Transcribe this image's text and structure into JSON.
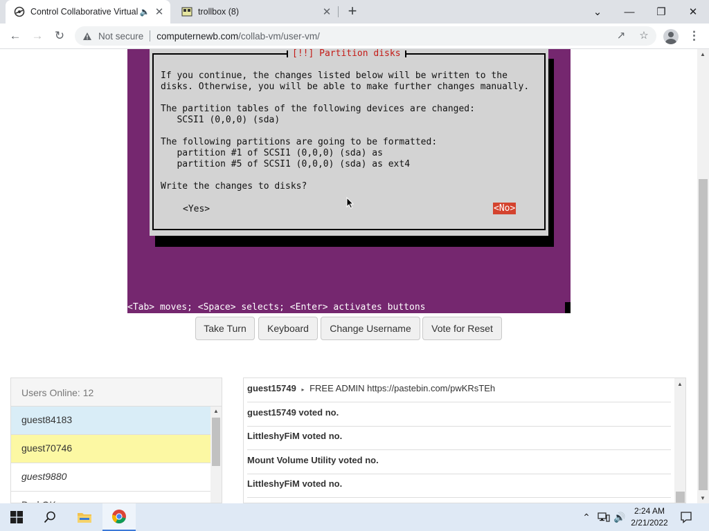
{
  "browser": {
    "tabs": [
      {
        "title": "Control Collaborative Virtual",
        "active": true,
        "audio": true
      },
      {
        "title": "trollbox (8)",
        "active": false
      }
    ],
    "security_label": "Not secure",
    "url_host": "computernewb.com",
    "url_path": "/collab-vm/user-vm/"
  },
  "vm": {
    "dialog_title": "[!!] Partition disks",
    "line1": "If you continue, the changes listed below will be written to the",
    "line2": "disks. Otherwise, you will be able to make further changes manually.",
    "line3": "The partition tables of the following devices are changed:",
    "line4": "   SCSI1 (0,0,0) (sda)",
    "line5": "The following partitions are going to be formatted:",
    "line6": "   partition #1 of SCSI1 (0,0,0) (sda) as",
    "line7": "   partition #5 of SCSI1 (0,0,0) (sda) as ext4",
    "line8": "Write the changes to disks?",
    "yes_label": "<Yes>",
    "no_label": "<No>",
    "help_line": "<Tab> moves; <Space> selects; <Enter> activates buttons"
  },
  "controls": {
    "take_turn": "Take Turn",
    "keyboard": "Keyboard",
    "change_username": "Change Username",
    "vote_reset": "Vote for Reset"
  },
  "users": {
    "header": "Users Online: 12",
    "list": [
      "guest84183",
      "guest70746",
      "guest9880",
      "DarkOK"
    ]
  },
  "chat": {
    "messages": [
      {
        "user": "guest15749",
        "sep": "▸",
        "text": "FREE ADMIN https://pastebin.com/pwKRsTEh"
      },
      {
        "text": "guest15749 voted no."
      },
      {
        "text": "LittleshyFiM voted no."
      },
      {
        "text": "Mount Volume Utility voted no."
      },
      {
        "text": "LittleshyFiM voted no."
      }
    ]
  },
  "taskbar": {
    "time": "2:24 AM",
    "date": "2/21/2022"
  },
  "colors": {
    "vm_background": "#75276f",
    "dialog_background": "#d3d3d3",
    "dialog_title": "#c41a16",
    "no_button": "#d4432e",
    "user_highlight_blue": "#d9edf7",
    "user_highlight_yellow": "#fcf8a3"
  }
}
